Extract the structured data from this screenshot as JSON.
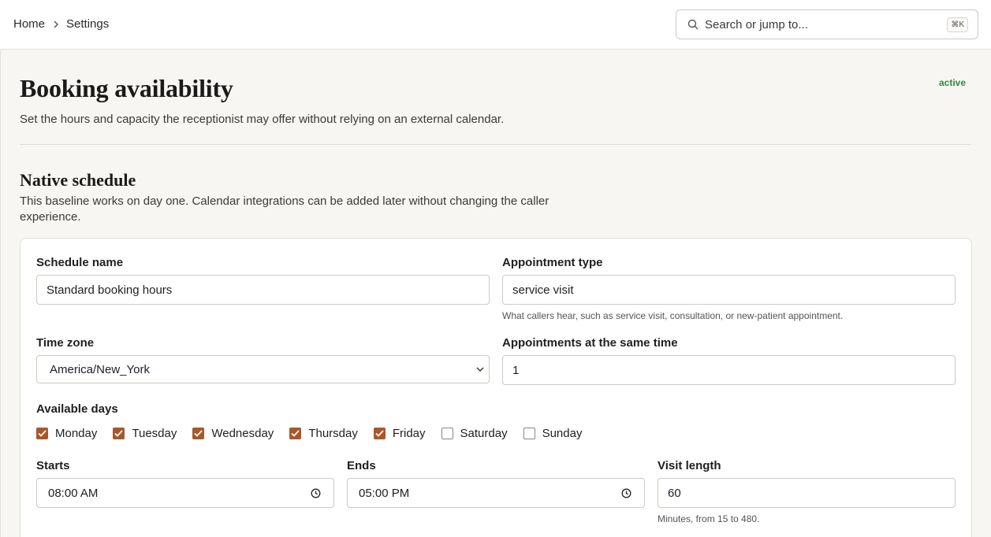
{
  "breadcrumb": {
    "home": "Home",
    "current": "Settings"
  },
  "search": {
    "placeholder": "Search or jump to...",
    "shortcut": "⌘K"
  },
  "page": {
    "title": "Booking availability",
    "status": "active",
    "description": "Set the hours and capacity the receptionist may offer without relying on an external calendar."
  },
  "section": {
    "title": "Native schedule",
    "description": "This baseline works on day one. Calendar integrations can be added later without changing the caller experience."
  },
  "form": {
    "schedule_name": {
      "label": "Schedule name",
      "value": "Standard booking hours"
    },
    "appointment_type": {
      "label": "Appointment type",
      "value": "service visit",
      "hint": "What callers hear, such as service visit, consultation, or new-patient appointment."
    },
    "time_zone": {
      "label": "Time zone",
      "value": "America/New_York"
    },
    "concurrent": {
      "label": "Appointments at the same time",
      "value": "1"
    },
    "available_days": {
      "label": "Available days",
      "days": [
        {
          "label": "Monday",
          "checked": true
        },
        {
          "label": "Tuesday",
          "checked": true
        },
        {
          "label": "Wednesday",
          "checked": true
        },
        {
          "label": "Thursday",
          "checked": true
        },
        {
          "label": "Friday",
          "checked": true
        },
        {
          "label": "Saturday",
          "checked": false
        },
        {
          "label": "Sunday",
          "checked": false
        }
      ]
    },
    "starts": {
      "label": "Starts",
      "value": "08:00 AM"
    },
    "ends": {
      "label": "Ends",
      "value": "05:00 PM"
    },
    "visit_length": {
      "label": "Visit length",
      "value": "60",
      "hint": "Minutes, from 15 to 480."
    }
  },
  "colors": {
    "accent": "#a9572a",
    "status": "#2f8a3e",
    "background": "#f8f6f2"
  }
}
